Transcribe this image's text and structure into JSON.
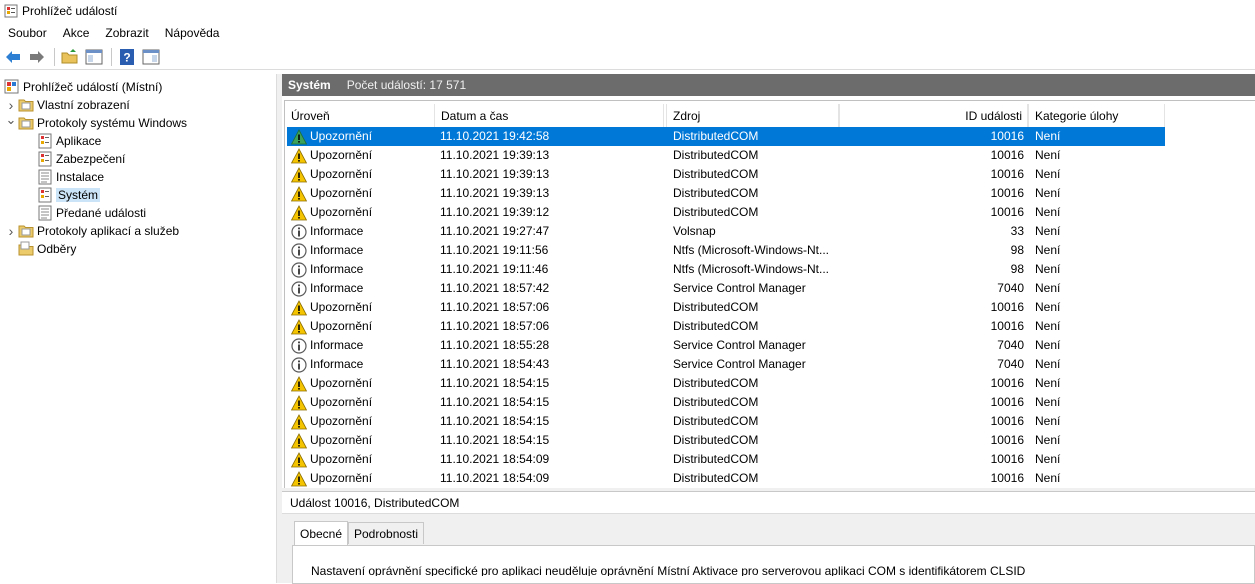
{
  "window": {
    "title": "Prohlížeč událostí"
  },
  "menu": [
    "Soubor",
    "Akce",
    "Zobrazit",
    "Nápověda"
  ],
  "tree": [
    {
      "label": "Prohlížeč událostí (Místní)",
      "level": 0,
      "expander": "",
      "icon": "event-viewer-icon"
    },
    {
      "label": "Vlastní zobrazení",
      "level": 1,
      "expander": "collapsed",
      "icon": "folder-icon"
    },
    {
      "label": "Protokoly systému Windows",
      "level": 1,
      "expander": "expanded",
      "icon": "folder-icon"
    },
    {
      "label": "Aplikace",
      "level": 2,
      "expander": "",
      "icon": "log-icon"
    },
    {
      "label": "Zabezpečení",
      "level": 2,
      "expander": "",
      "icon": "log-icon"
    },
    {
      "label": "Instalace",
      "level": 2,
      "expander": "",
      "icon": "log-plain-icon"
    },
    {
      "label": "Systém",
      "level": 2,
      "expander": "",
      "icon": "log-icon",
      "selected": true
    },
    {
      "label": "Předané události",
      "level": 2,
      "expander": "",
      "icon": "log-plain-icon"
    },
    {
      "label": "Protokoly aplikací a služeb",
      "level": 1,
      "expander": "collapsed",
      "icon": "folder-icon"
    },
    {
      "label": "Odběry",
      "level": 1,
      "expander": "",
      "icon": "subscription-icon"
    }
  ],
  "pane": {
    "title": "Systém",
    "count": "Počet událostí: 17 571"
  },
  "columns": {
    "level": "Úroveň",
    "datetime": "Datum a čas",
    "source": "Zdroj",
    "id": "ID události",
    "category": "Kategorie úlohy"
  },
  "events": [
    {
      "level": "Upozornění",
      "type": "warning",
      "datetime": "11.10.2021 19:42:58",
      "source": "DistributedCOM",
      "id": "10016",
      "category": "Není",
      "selected": true
    },
    {
      "level": "Upozornění",
      "type": "warning",
      "datetime": "11.10.2021 19:39:13",
      "source": "DistributedCOM",
      "id": "10016",
      "category": "Není"
    },
    {
      "level": "Upozornění",
      "type": "warning",
      "datetime": "11.10.2021 19:39:13",
      "source": "DistributedCOM",
      "id": "10016",
      "category": "Není"
    },
    {
      "level": "Upozornění",
      "type": "warning",
      "datetime": "11.10.2021 19:39:13",
      "source": "DistributedCOM",
      "id": "10016",
      "category": "Není"
    },
    {
      "level": "Upozornění",
      "type": "warning",
      "datetime": "11.10.2021 19:39:12",
      "source": "DistributedCOM",
      "id": "10016",
      "category": "Není"
    },
    {
      "level": "Informace",
      "type": "info",
      "datetime": "11.10.2021 19:27:47",
      "source": "Volsnap",
      "id": "33",
      "category": "Není"
    },
    {
      "level": "Informace",
      "type": "info",
      "datetime": "11.10.2021 19:11:56",
      "source": "Ntfs (Microsoft-Windows-Nt...",
      "id": "98",
      "category": "Není"
    },
    {
      "level": "Informace",
      "type": "info",
      "datetime": "11.10.2021 19:11:46",
      "source": "Ntfs (Microsoft-Windows-Nt...",
      "id": "98",
      "category": "Není"
    },
    {
      "level": "Informace",
      "type": "info",
      "datetime": "11.10.2021 18:57:42",
      "source": "Service Control Manager",
      "id": "7040",
      "category": "Není"
    },
    {
      "level": "Upozornění",
      "type": "warning",
      "datetime": "11.10.2021 18:57:06",
      "source": "DistributedCOM",
      "id": "10016",
      "category": "Není"
    },
    {
      "level": "Upozornění",
      "type": "warning",
      "datetime": "11.10.2021 18:57:06",
      "source": "DistributedCOM",
      "id": "10016",
      "category": "Není"
    },
    {
      "level": "Informace",
      "type": "info",
      "datetime": "11.10.2021 18:55:28",
      "source": "Service Control Manager",
      "id": "7040",
      "category": "Není"
    },
    {
      "level": "Informace",
      "type": "info",
      "datetime": "11.10.2021 18:54:43",
      "source": "Service Control Manager",
      "id": "7040",
      "category": "Není"
    },
    {
      "level": "Upozornění",
      "type": "warning",
      "datetime": "11.10.2021 18:54:15",
      "source": "DistributedCOM",
      "id": "10016",
      "category": "Není"
    },
    {
      "level": "Upozornění",
      "type": "warning",
      "datetime": "11.10.2021 18:54:15",
      "source": "DistributedCOM",
      "id": "10016",
      "category": "Není"
    },
    {
      "level": "Upozornění",
      "type": "warning",
      "datetime": "11.10.2021 18:54:15",
      "source": "DistributedCOM",
      "id": "10016",
      "category": "Není"
    },
    {
      "level": "Upozornění",
      "type": "warning",
      "datetime": "11.10.2021 18:54:15",
      "source": "DistributedCOM",
      "id": "10016",
      "category": "Není"
    },
    {
      "level": "Upozornění",
      "type": "warning",
      "datetime": "11.10.2021 18:54:09",
      "source": "DistributedCOM",
      "id": "10016",
      "category": "Není"
    },
    {
      "level": "Upozornění",
      "type": "warning",
      "datetime": "11.10.2021 18:54:09",
      "source": "DistributedCOM",
      "id": "10016",
      "category": "Není"
    }
  ],
  "detail": {
    "title": "Událost 10016, DistributedCOM",
    "tabs": [
      "Obecné",
      "Podrobnosti"
    ],
    "text": "Nastavení oprávnění specifické pro aplikaci neuděluje oprávnění Místní Aktivace pro serverovou aplikaci COM s identifikátorem CLSID"
  },
  "colors": {
    "selection": "#0078d7",
    "header": "#6c6c6c",
    "warning": "#f5c400",
    "info": "#1a4f9c"
  }
}
